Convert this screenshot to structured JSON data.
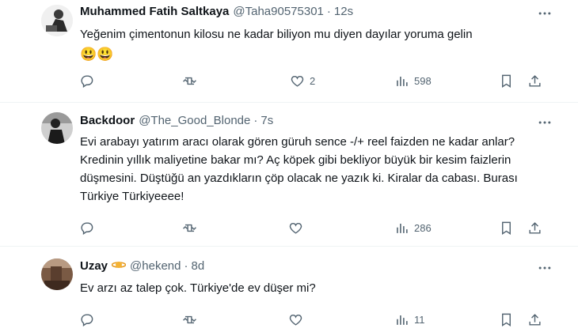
{
  "tweets": [
    {
      "name": "Muhammed Fatih Saltkaya",
      "handle": "@Taha90575301",
      "separator": "·",
      "time": "12s",
      "text": "Yeğenim çimentonun kilosu ne kadar biliyon mu diyen dayılar yoruma gelin",
      "emoji": "😃😃",
      "reply_count": "",
      "retweet_count": "",
      "like_count": "2",
      "view_count": "598"
    },
    {
      "name": "Backdoor",
      "handle": "@The_Good_Blonde",
      "separator": "·",
      "time": "7s",
      "text": "Evi arabayı yatırım aracı olarak gören güruh sence -/+ reel faizden ne kadar anlar? Kredinin yıllık maliyetine bakar mı? Aç köpek gibi bekliyor büyük bir kesim faizlerin düşmesini. Düştüğü an yazdıkların çöp olacak ne yazık ki. Kiralar da cabası. Burası Türkiye Türkiyeeee!",
      "reply_count": "",
      "retweet_count": "",
      "like_count": "",
      "view_count": "286"
    },
    {
      "name": "Uzay",
      "handle": "@hekend",
      "separator": "·",
      "time": "8d",
      "text": "Ev arzı az talep çok. Türkiye'de ev düşer mi?",
      "reply_count": "",
      "retweet_count": "",
      "like_count": "",
      "view_count": "11"
    }
  ],
  "colors": {
    "text": "#0f1419",
    "secondary": "#536471",
    "divider": "#eff3f4"
  },
  "icons": [
    "more-icon",
    "reply-icon",
    "retweet-icon",
    "like-icon",
    "views-icon",
    "bookmark-icon",
    "share-icon"
  ]
}
